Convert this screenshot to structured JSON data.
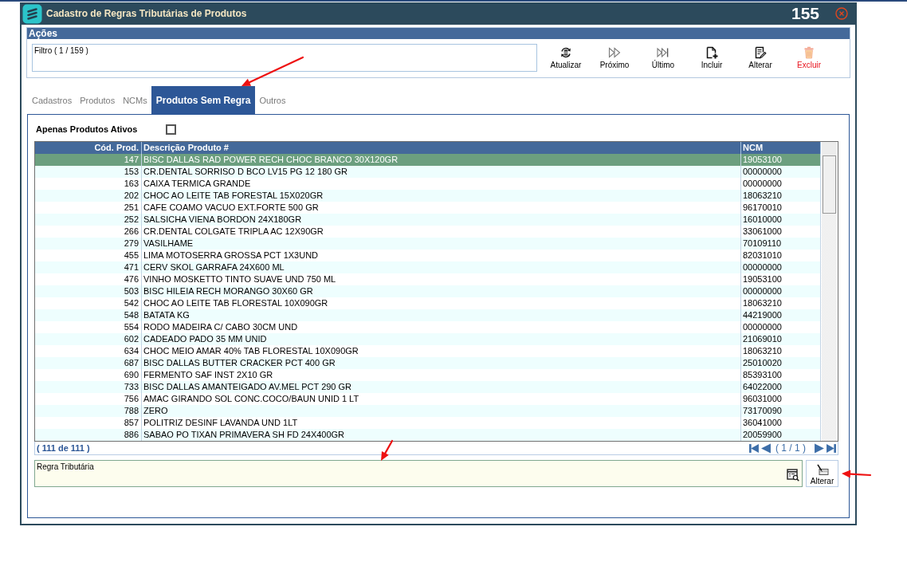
{
  "window": {
    "title": "Cadastro de Regras Tributárias de Produtos",
    "number": "155"
  },
  "actions": {
    "title": "Ações",
    "filter": "Filtro ( 1 / 159 )",
    "buttons": [
      {
        "label": "Atualizar",
        "kind": "refresh"
      },
      {
        "label": "Próximo",
        "kind": "next"
      },
      {
        "label": "Último",
        "kind": "last"
      },
      {
        "label": "Incluir",
        "kind": "add"
      },
      {
        "label": "Alterar",
        "kind": "edit"
      },
      {
        "label": "Excluir",
        "kind": "delete"
      }
    ]
  },
  "tabs": [
    {
      "label": "Cadastros",
      "selected": false
    },
    {
      "label": "Produtos",
      "selected": false
    },
    {
      "label": "NCMs",
      "selected": false
    },
    {
      "label": "Produtos Sem Regra",
      "selected": true
    },
    {
      "label": "Outros",
      "selected": false
    }
  ],
  "active_only": {
    "label": "Apenas Produtos Ativos",
    "checked": false
  },
  "table": {
    "columns": [
      "Cód. Prod.",
      "Descrição Produto #",
      "NCM"
    ],
    "rows": [
      {
        "cells": [
          "147",
          "BISC DALLAS RAD POWER RECH CHOC BRANCO 30X120GR",
          "19053100"
        ],
        "selected": true
      },
      {
        "cells": [
          "153",
          "CR.DENTAL SORRISO D BCO LV15 PG 12 180 GR",
          "00000000"
        ],
        "selected": false
      },
      {
        "cells": [
          "163",
          "CAIXA TERMICA GRANDE",
          "00000000"
        ],
        "selected": false
      },
      {
        "cells": [
          "202",
          "CHOC AO LEITE TAB FORESTAL 15X020GR",
          "18063210"
        ],
        "selected": false
      },
      {
        "cells": [
          "251",
          "CAFE COAMO VACUO EXT.FORTE 500 GR",
          "96170010"
        ],
        "selected": false
      },
      {
        "cells": [
          "252",
          "SALSICHA VIENA BORDON 24X180GR",
          "16010000"
        ],
        "selected": false
      },
      {
        "cells": [
          "266",
          "CR.DENTAL COLGATE TRIPLA AC 12X90GR",
          "33061000"
        ],
        "selected": false
      },
      {
        "cells": [
          "279",
          "VASILHAME",
          "70109110"
        ],
        "selected": false
      },
      {
        "cells": [
          "455",
          "LIMA MOTOSERRA GROSSA PCT 1X3UND",
          "82031010"
        ],
        "selected": false
      },
      {
        "cells": [
          "471",
          "CERV SKOL GARRAFA 24X600 ML",
          "00000000"
        ],
        "selected": false
      },
      {
        "cells": [
          "476",
          "VINHO MOSKETTO TINTO SUAVE UND 750 ML",
          "19053100"
        ],
        "selected": false
      },
      {
        "cells": [
          "503",
          "BISC HILEIA RECH MORANGO 30X60 GR",
          "00000000"
        ],
        "selected": false
      },
      {
        "cells": [
          "542",
          "CHOC AO LEITE TAB FLORESTAL 10X090GR",
          "18063210"
        ],
        "selected": false
      },
      {
        "cells": [
          "548",
          "BATATA KG",
          "44219000"
        ],
        "selected": false
      },
      {
        "cells": [
          "554",
          "RODO MADEIRA C/ CABO 30CM UND",
          "00000000"
        ],
        "selected": false
      },
      {
        "cells": [
          "602",
          "CADEADO PADO 35 MM UNID",
          "21069010"
        ],
        "selected": false
      },
      {
        "cells": [
          "634",
          "CHOC MEIO AMAR 40% TAB FLORESTAL 10X090GR",
          "18063210"
        ],
        "selected": false
      },
      {
        "cells": [
          "687",
          "BISC DALLAS BUTTER CRACKER PCT 400 GR",
          "25010020"
        ],
        "selected": false
      },
      {
        "cells": [
          "690",
          "FERMENTO SAF INST 2X10 GR",
          "85393100"
        ],
        "selected": false
      },
      {
        "cells": [
          "733",
          "BISC DALLAS AMANTEIGADO AV.MEL PCT 290 GR",
          "64022000"
        ],
        "selected": false
      },
      {
        "cells": [
          "756",
          "AMAC GIRANDO SOL CONC.COCO/BAUN UNID 1 LT",
          "96031000"
        ],
        "selected": false
      },
      {
        "cells": [
          "788",
          "ZERO",
          "73170090"
        ],
        "selected": false
      },
      {
        "cells": [
          "857",
          "POLITRIZ DESINF LAVANDA UND 1LT",
          "36041000"
        ],
        "selected": false
      },
      {
        "cells": [
          "886",
          "SABAO PO TIXAN PRIMAVERA SH FD 24X400GR",
          "20059900"
        ],
        "selected": false
      }
    ]
  },
  "table_footer": {
    "count": "( 111 de 111 )",
    "page": "( 1 / 1 )"
  },
  "rule": {
    "label": "Regra Tributária",
    "button": "Alterar"
  },
  "annotations": [
    {
      "kind": "arrow"
    },
    {
      "kind": "arrow"
    },
    {
      "kind": "arrow"
    }
  ]
}
